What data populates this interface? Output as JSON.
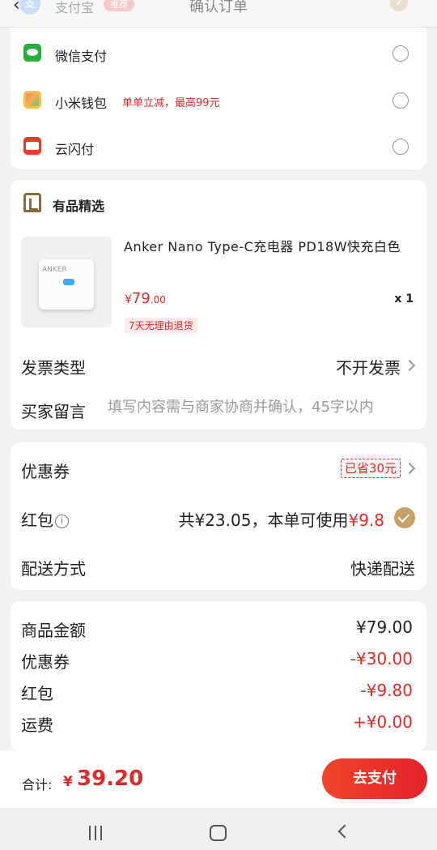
{
  "header": {
    "title": "确认订单",
    "top_method_label": "支付宝",
    "top_method_tag": "推荐"
  },
  "payment_methods": [
    {
      "label": "微信支付",
      "promo": "",
      "icon": "wechat-pay-icon",
      "selected": false
    },
    {
      "label": "小米钱包",
      "promo": "单单立减，最高99元",
      "icon": "xiaomi-wallet-icon",
      "selected": false
    },
    {
      "label": "云闪付",
      "promo": "",
      "icon": "unionpay-quickpass-icon",
      "selected": false
    }
  ],
  "shop": {
    "name": "有品精选",
    "icon": "shop-icon"
  },
  "product": {
    "image_brand": "ANKER",
    "title": "Anker Nano Type-C充电器 PD18W快充白色",
    "price_currency": "¥",
    "price_int": "79",
    "price_dec": ".00",
    "quantity": "x 1",
    "return_policy": "7天无理由退货"
  },
  "invoice": {
    "label": "发票类型",
    "value": "不开发票"
  },
  "message": {
    "label": "买家留言",
    "placeholder": "填写内容需与商家协商并确认，45字以内"
  },
  "coupon": {
    "label": "优惠券",
    "saved": "已省30元"
  },
  "hongbao": {
    "label": "红包",
    "info_icon": "ⓘ",
    "value_prefix": "共¥23.05，本单可使用",
    "value_amount": "¥9.8",
    "checked": true
  },
  "shipping": {
    "label": "配送方式",
    "value": "快递配送"
  },
  "summary": [
    {
      "label": "商品金额",
      "value": "¥79.00",
      "style": "dark"
    },
    {
      "label": "优惠券",
      "value": "-¥30.00",
      "style": "red"
    },
    {
      "label": "红包",
      "value": "-¥9.80",
      "style": "red"
    },
    {
      "label": "运费",
      "value": "+¥0.00",
      "style": "red"
    }
  ],
  "footer": {
    "total_label": "合计:",
    "total_currency": "¥",
    "total_amount": "39.20",
    "pay_button": "去支付"
  },
  "colors": {
    "accent_red": "#e02a2a",
    "gold": "#c8a06a"
  }
}
